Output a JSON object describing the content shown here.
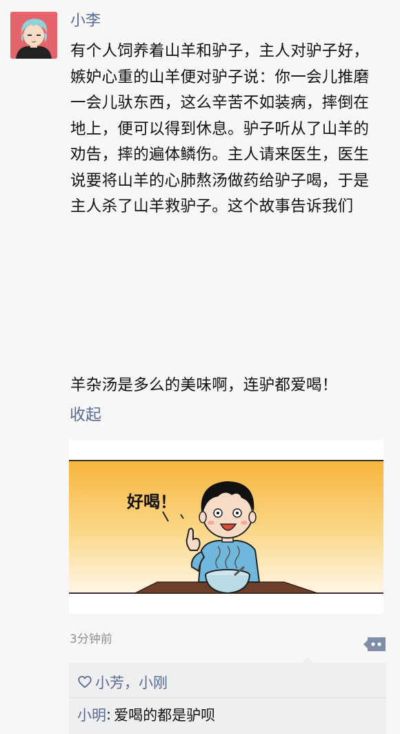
{
  "post": {
    "author": "小李",
    "text_lines": [
      "有个人饲养着山羊和驴子，主人对驴子好，",
      "嫉妒心重的山羊便对驴子说：你一会儿推磨",
      "一会儿驮东西，这么辛苦不如装病，摔倒在",
      "地上，便可以得到休息。驴子听从了山羊的",
      "劝告，摔的遍体鳞伤。主人请来医生，医生",
      "说要将山羊的心肺熬汤做药给驴子喝，于是",
      "主人杀了山羊救驴子。这个故事告诉我们"
    ],
    "punchline": "羊杂汤是多么的美味啊，连驴都爱喝！",
    "collapse_label": "收起",
    "image": {
      "speech_text": "好喝！"
    },
    "timestamp": "3分钟前"
  },
  "interactions": {
    "likes": "小芳，小刚",
    "comment": {
      "author": "小明",
      "separator": ":",
      "text": "爱喝的都是驴呗"
    }
  },
  "icons": {
    "heart": "heart-outline-icon",
    "more": "more-dots-icon"
  },
  "colors": {
    "link": "#576b95",
    "background": "#f7f7f7",
    "panel": "#efefef"
  }
}
